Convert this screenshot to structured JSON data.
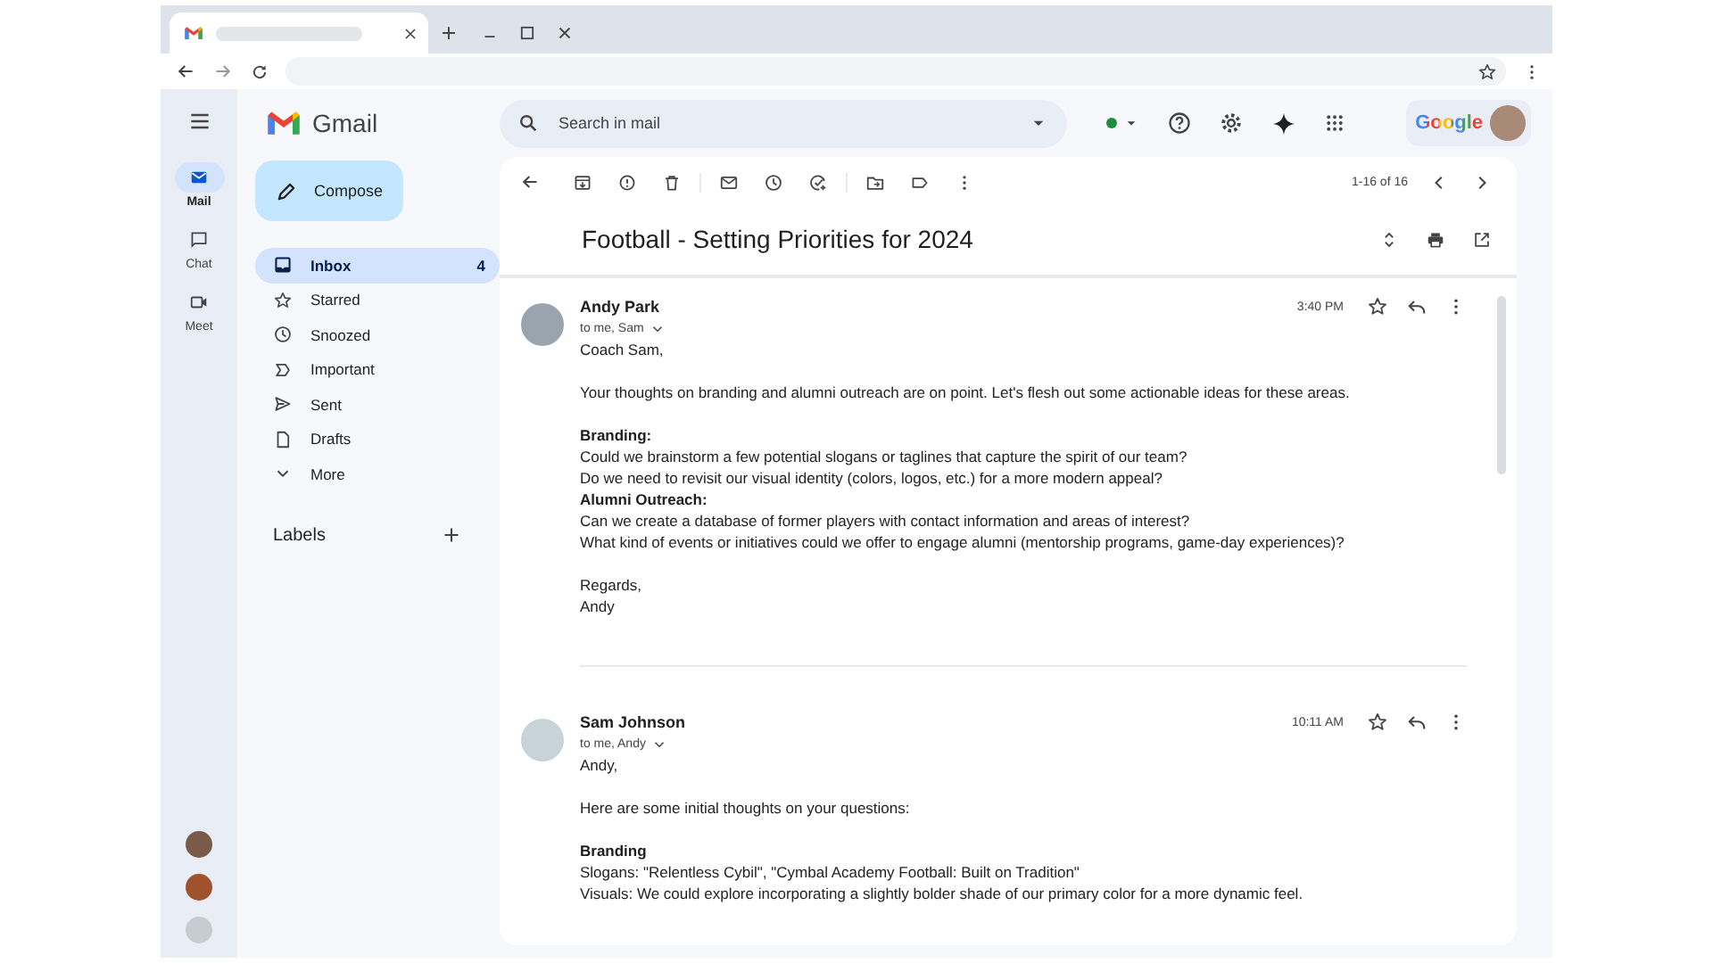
{
  "app": {
    "name": "Gmail"
  },
  "rail": [
    {
      "kind": "mail",
      "label": "Mail",
      "selected": true
    },
    {
      "kind": "chat",
      "label": "Chat",
      "selected": false
    },
    {
      "kind": "meet",
      "label": "Meet",
      "selected": false
    }
  ],
  "search": {
    "placeholder": "Search in mail"
  },
  "account": {
    "brand": "Google"
  },
  "compose": {
    "label": "Compose"
  },
  "nav": [
    {
      "kind": "inbox",
      "label": "Inbox",
      "count": "4",
      "selected": true
    },
    {
      "kind": "starred",
      "label": "Starred",
      "selected": false
    },
    {
      "kind": "snoozed",
      "label": "Snoozed",
      "selected": false
    },
    {
      "kind": "important",
      "label": "Important",
      "selected": false
    },
    {
      "kind": "sent",
      "label": "Sent",
      "selected": false
    },
    {
      "kind": "drafts",
      "label": "Drafts",
      "selected": false
    },
    {
      "kind": "more",
      "label": "More",
      "selected": false
    }
  ],
  "labels": {
    "title": "Labels"
  },
  "toolbar": {
    "range": "1-16 of 16"
  },
  "thread": {
    "subject": "Football - Setting Priorities for 2024",
    "messages": [
      {
        "sender": "Andy Park",
        "recipients": "to me, Sam",
        "time": "3:40 PM",
        "paragraphs": [
          [
            {
              "kind": "text",
              "text": "Coach Sam,"
            }
          ],
          [
            {
              "kind": "text",
              "text": "Your thoughts on branding and alumni outreach are on point. Let's flesh out some actionable ideas for these areas."
            }
          ],
          [
            {
              "kind": "heading",
              "text": "Branding:"
            },
            {
              "kind": "text",
              "text": "Could we brainstorm a few potential slogans or taglines that capture the spirit of our team?"
            },
            {
              "kind": "text",
              "text": "Do we need to revisit our visual identity (colors, logos, etc.) for a more modern appeal?"
            },
            {
              "kind": "heading",
              "text": "Alumni Outreach:"
            },
            {
              "kind": "text",
              "text": "Can we create a database of former players with contact information and areas of interest?"
            },
            {
              "kind": "text",
              "text": "What kind of events or initiatives could we offer to engage alumni (mentorship programs, game-day experiences)?"
            }
          ],
          [
            {
              "kind": "text",
              "text": "Regards,"
            },
            {
              "kind": "text",
              "text": "Andy"
            }
          ]
        ]
      },
      {
        "sender": "Sam Johnson",
        "recipients": "to me, Andy",
        "time": "10:11 AM",
        "paragraphs": [
          [
            {
              "kind": "text",
              "text": "Andy,"
            }
          ],
          [
            {
              "kind": "text",
              "text": "Here are some initial thoughts on your questions:"
            }
          ],
          [
            {
              "kind": "heading",
              "text": "Branding"
            },
            {
              "kind": "text",
              "text": "Slogans: \"Relentless Cybil\", \"Cymbal Academy Football: Built on Tradition\""
            },
            {
              "kind": "text",
              "text": "Visuals: We could explore incorporating a slightly bolder shade of our primary color for a more dynamic feel."
            }
          ]
        ]
      }
    ]
  }
}
